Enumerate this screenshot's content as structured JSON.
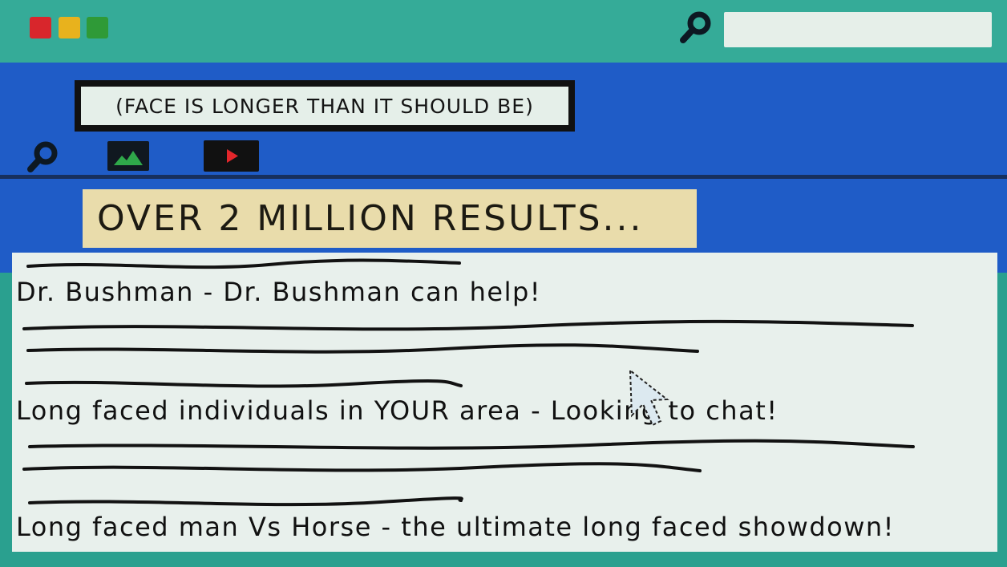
{
  "window": {
    "traffic_lights": [
      {
        "name": "close",
        "color": "#d8262c"
      },
      {
        "name": "minimize",
        "color": "#e8b21d"
      },
      {
        "name": "maximize",
        "color": "#2f9a37"
      }
    ],
    "search_icon": "magnifier-icon",
    "address_value": ""
  },
  "search": {
    "query": "(FACE IS LONGER THAN IT SHOULD BE)",
    "tools": [
      "search-icon",
      "images-icon",
      "video-icon"
    ]
  },
  "summary": "OVER 2 MILLION RESULTS...",
  "results": [
    {
      "title": "Dr. Bushman - Dr. Bushman can help!"
    },
    {
      "title": "Long faced individuals in YOUR area - Looking to chat!"
    },
    {
      "title": "Long faced man Vs Horse - the ultimate long faced showdown!"
    }
  ],
  "colors": {
    "frame": "#35ab98",
    "toolbar": "#1f5cc7",
    "banner": "#e9dcab",
    "panel": "#e8f0ec"
  }
}
